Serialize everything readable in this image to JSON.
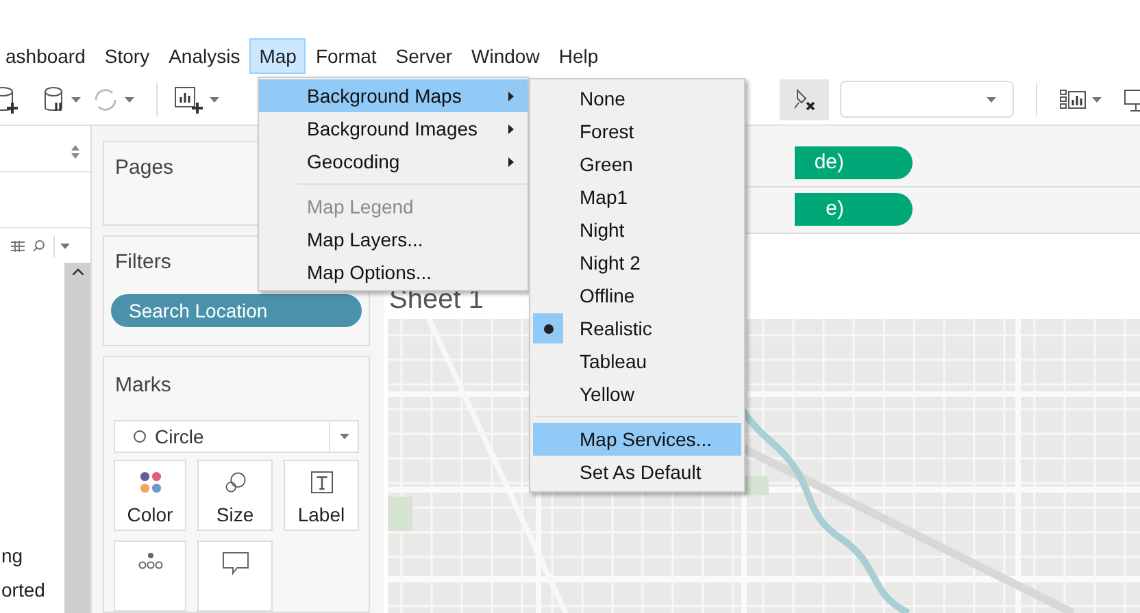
{
  "menubar": [
    {
      "label": "ashboard",
      "selected": false
    },
    {
      "label": "Story",
      "selected": false
    },
    {
      "label": "Analysis",
      "selected": false
    },
    {
      "label": "Map",
      "selected": true
    },
    {
      "label": "Format",
      "selected": false
    },
    {
      "label": "Server",
      "selected": false
    },
    {
      "label": "Window",
      "selected": false
    },
    {
      "label": "Help",
      "selected": false
    }
  ],
  "map_menu": [
    {
      "kind": "submenu",
      "label": "Background Maps",
      "highlighted": true,
      "disabled": false
    },
    {
      "kind": "submenu",
      "label": "Background Images",
      "highlighted": false,
      "disabled": false
    },
    {
      "kind": "submenu",
      "label": "Geocoding",
      "highlighted": false,
      "disabled": false
    },
    {
      "kind": "separator"
    },
    {
      "kind": "item",
      "label": "Map Legend",
      "highlighted": false,
      "disabled": true
    },
    {
      "kind": "item",
      "label": "Map Layers...",
      "highlighted": false,
      "disabled": false
    },
    {
      "kind": "item",
      "label": "Map Options...",
      "highlighted": false,
      "disabled": false
    }
  ],
  "background_maps_menu": [
    {
      "kind": "item",
      "label": "None",
      "checked": false,
      "highlighted": false
    },
    {
      "kind": "item",
      "label": "Forest",
      "checked": false,
      "highlighted": false
    },
    {
      "kind": "item",
      "label": "Green",
      "checked": false,
      "highlighted": false
    },
    {
      "kind": "item",
      "label": "Map1",
      "checked": false,
      "highlighted": false
    },
    {
      "kind": "item",
      "label": "Night",
      "checked": false,
      "highlighted": false
    },
    {
      "kind": "item",
      "label": "Night 2",
      "checked": false,
      "highlighted": false
    },
    {
      "kind": "item",
      "label": "Offline",
      "checked": false,
      "highlighted": false
    },
    {
      "kind": "item",
      "label": "Realistic",
      "checked": true,
      "highlighted": false
    },
    {
      "kind": "item",
      "label": "Tableau",
      "checked": false,
      "highlighted": false
    },
    {
      "kind": "item",
      "label": "Yellow",
      "checked": false,
      "highlighted": false
    },
    {
      "kind": "separator"
    },
    {
      "kind": "item",
      "label": "Map Services...",
      "checked": false,
      "highlighted": true
    },
    {
      "kind": "item",
      "label": "Set As Default",
      "checked": false,
      "highlighted": false
    }
  ],
  "data_pane": {
    "fields": [
      "ng",
      "orted"
    ]
  },
  "pages": {
    "title": "Pages"
  },
  "filters": {
    "title": "Filters",
    "pills": [
      "Search Location"
    ]
  },
  "marks": {
    "title": "Marks",
    "mark_type": "Circle",
    "buttons": [
      {
        "kind": "color",
        "label": "Color"
      },
      {
        "kind": "size",
        "label": "Size"
      },
      {
        "kind": "label",
        "label": "Label"
      },
      {
        "kind": "detail"
      },
      {
        "kind": "tooltip"
      }
    ]
  },
  "shelves": [
    {
      "pill": "de)"
    },
    {
      "pill": "e)"
    }
  ],
  "sheet": {
    "title": "Sheet 1"
  }
}
